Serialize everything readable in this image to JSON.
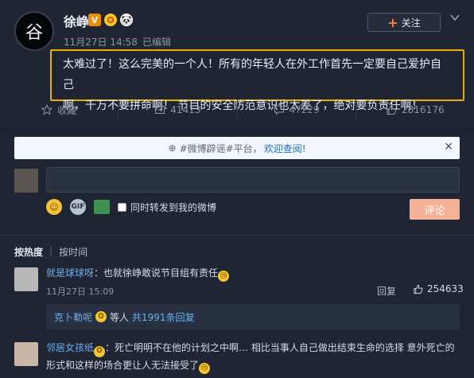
{
  "post": {
    "avatar_glyph": "谷",
    "username": "徐峥",
    "badge_v": "V",
    "badge_vip": "✪",
    "badge_panda": "🐼",
    "date": "11月27日 14:58",
    "edited": "已编辑",
    "follow_plus": "+",
    "follow_label": "关注",
    "text_line1": "太难过了！这么完美的一个人！所有的年轻人在外工作首先一定要自己爱护自己",
    "text_line2": "啊，千万不要拼命啊！ 节目的安全防范意识也太差了，绝对要负责任啊！"
  },
  "actions": {
    "favorite": "收藏",
    "repost": "41413",
    "comment": "47229",
    "like": "2816176"
  },
  "comments_section": {
    "notice_hash": "⊕",
    "notice_text": "#微博辟谣#平台，",
    "notice_link": "欢迎查阅!",
    "notice_close": "×",
    "repost_label": "同时转发到我的微博",
    "submit_label": "评论",
    "sort_hot": "按热度",
    "sort_sep": "|",
    "sort_time": "按时间",
    "gif_label": "GIF"
  },
  "comment1": {
    "user": "就是球球呀",
    "text": "：也就徐峥敢说节目组有责任",
    "emoji": "😢",
    "time": "11月27日 15:09",
    "reply": "回复",
    "likes": "254633",
    "reply_user": "克卜勒呢",
    "reply_mid": "等人",
    "reply_count": "共1991条回复"
  },
  "comment2": {
    "user": "邻居女孩纸",
    "text": "：死亡明明不在他的计划之中啊… 相比当事人自己做出结束生命的选择 意外死亡的形式和这样的场合更让人无法接受了",
    "emoji": "😢"
  },
  "colors": {
    "accent_orange": "#ff8140",
    "highlight_border": "#e6b400",
    "link_blue": "#6ab0ee",
    "submit_bg": "#f5b098"
  }
}
